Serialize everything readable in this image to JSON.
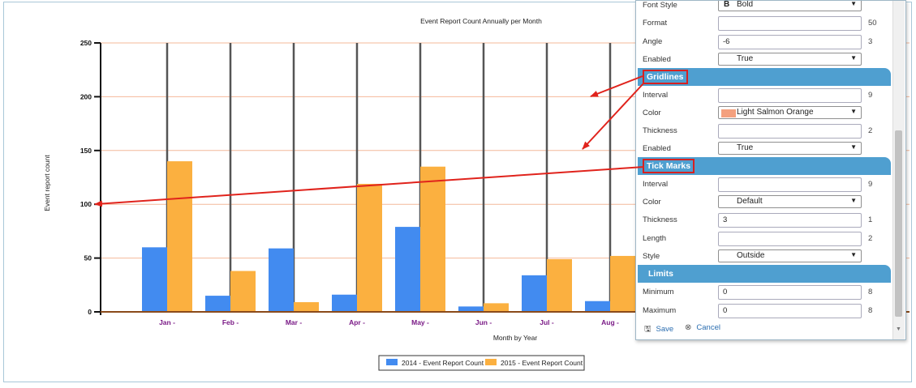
{
  "chart_data": {
    "type": "bar",
    "title": "Event Report Count Annually per Month",
    "xlabel": "Month by Year",
    "ylabel": "Event report count",
    "categories": [
      "Jan -",
      "Feb -",
      "Mar -",
      "Apr -",
      "May -",
      "Jun -",
      "Jul -",
      "Aug -"
    ],
    "series": [
      {
        "name": "2014 - Event Report Count",
        "values": [
          60,
          15,
          59,
          16,
          79,
          5,
          34,
          10
        ],
        "color": "#428bf0"
      },
      {
        "name": "2015 - Event Report Count",
        "values": [
          140,
          38,
          9,
          119,
          135,
          8,
          49,
          52
        ],
        "color": "#fbb040"
      }
    ],
    "ylim": [
      0,
      250
    ],
    "yticks": [
      0,
      50,
      100,
      150,
      200,
      250
    ],
    "grid": true,
    "gridline_color": "#f4b89a",
    "legend_position": "bottom-center"
  },
  "panel": {
    "rows": [
      {
        "label": "Font Style",
        "type": "select",
        "value": "Bold",
        "prefix": "B",
        "default": ""
      },
      {
        "label": "Format",
        "type": "input",
        "value": "",
        "default": "50"
      },
      {
        "label": "Angle",
        "type": "input",
        "value": "-6",
        "default": "3"
      },
      {
        "label": "Enabled",
        "type": "select",
        "value": "True",
        "default": ""
      }
    ],
    "gridlines": {
      "title": "Gridlines",
      "rows": [
        {
          "label": "Interval",
          "type": "input",
          "value": "",
          "default": "9"
        },
        {
          "label": "Color",
          "type": "select",
          "value": "Light Salmon Orange",
          "default": "",
          "swatch": "#f4a07e"
        },
        {
          "label": "Thickness",
          "type": "input",
          "value": "",
          "default": "2"
        },
        {
          "label": "Enabled",
          "type": "select",
          "value": "True",
          "default": ""
        }
      ]
    },
    "tick_marks": {
      "title": "Tick Marks",
      "rows": [
        {
          "label": "Interval",
          "type": "input",
          "value": "",
          "default": "9"
        },
        {
          "label": "Color",
          "type": "select",
          "value": "Default",
          "default": ""
        },
        {
          "label": "Thickness",
          "type": "input",
          "value": "3",
          "default": "1"
        },
        {
          "label": "Length",
          "type": "input",
          "value": "",
          "default": "2"
        },
        {
          "label": "Style",
          "type": "select",
          "value": "Outside",
          "default": ""
        }
      ]
    },
    "limits": {
      "title": "Limits",
      "rows": [
        {
          "label": "Minimum",
          "type": "input",
          "value": "0",
          "default": "8"
        },
        {
          "label": "Maximum",
          "type": "input",
          "value": "0",
          "default": "8"
        }
      ]
    },
    "save_label": "Save",
    "cancel_label": "Cancel"
  }
}
